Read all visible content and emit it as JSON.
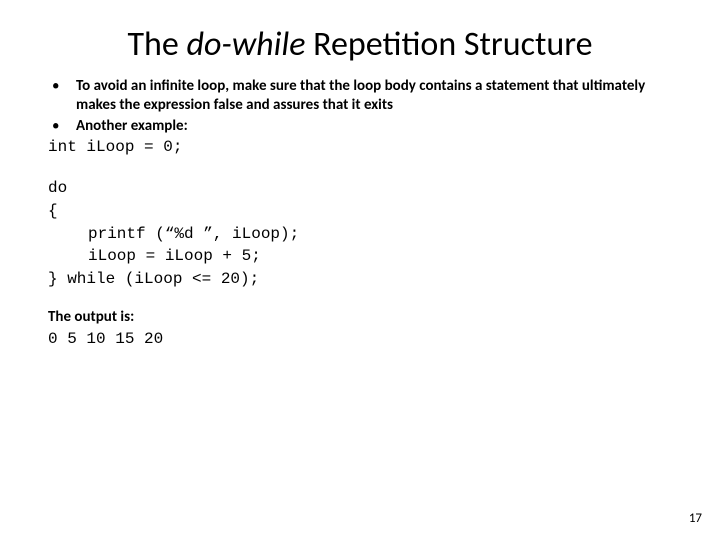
{
  "title": {
    "pre": "The ",
    "italic": "do-while",
    "post": " Repetition Structure"
  },
  "bullets": [
    "To avoid an infinite loop, make sure that the loop body contains a statement that ultimately makes the expression false and assures that it exits",
    "Another example:"
  ],
  "code": {
    "decl": "int iLoop = 0;",
    "l1": "do",
    "l2": "{",
    "l3": "printf (“%d ”, iLoop);",
    "l4": "iLoop = iLoop + 5;",
    "l5": "} while (iLoop <= 20);"
  },
  "output_label": "The output is:",
  "output_line": "0 5 10 15 20",
  "page_number": "17"
}
